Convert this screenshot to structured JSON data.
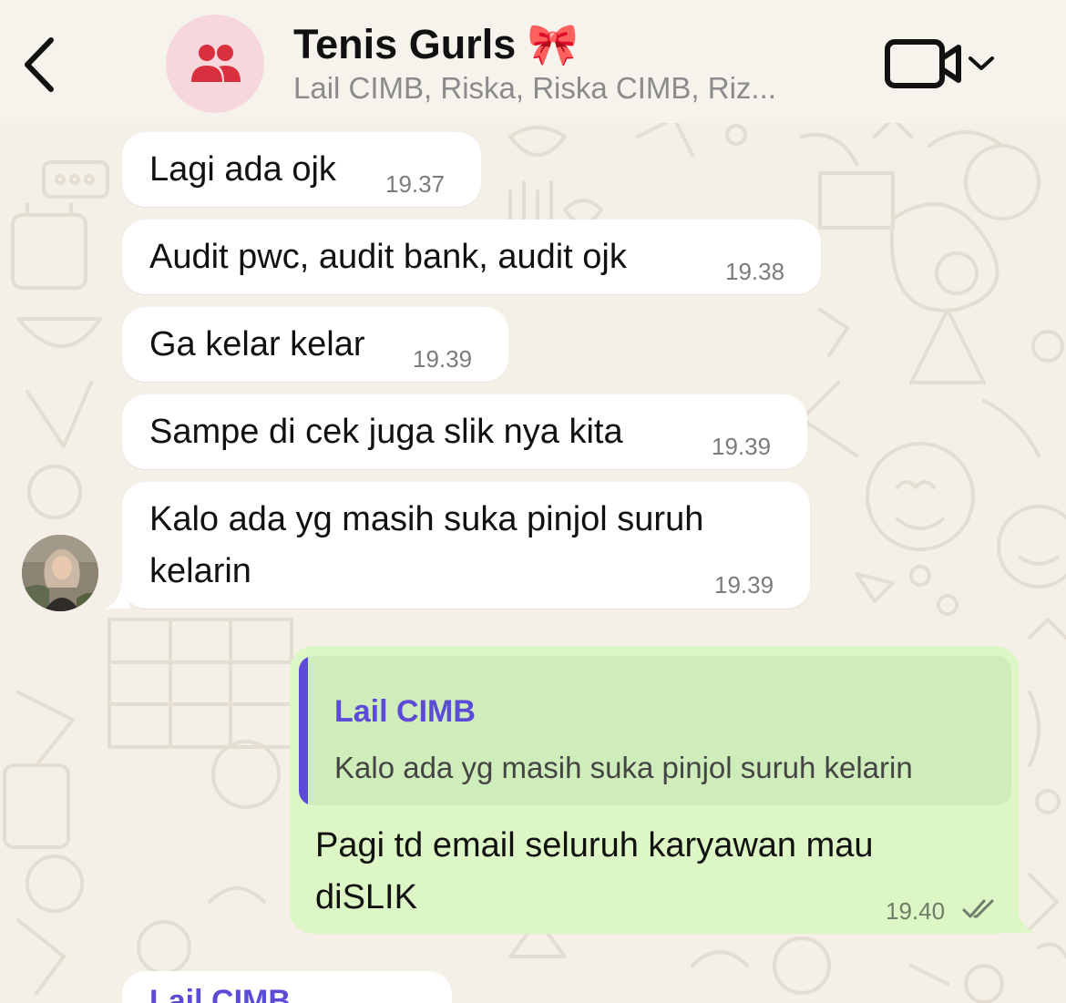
{
  "header": {
    "title": "Tenis Gurls 🎀",
    "subtitle": "Lail CIMB, Riska, Riska CIMB, Riz..."
  },
  "messages": [
    {
      "text": "Lagi ada ojk",
      "time": "19.37"
    },
    {
      "text": "Audit pwc, audit bank, audit ojk",
      "time": "19.38"
    },
    {
      "text": "Ga kelar kelar",
      "time": "19.39"
    },
    {
      "text": "Sampe di cek juga slik nya kita",
      "time": "19.39"
    },
    {
      "line1": "Kalo ada yg masih suka pinjol suruh",
      "line2": "kelarin",
      "time": "19.39"
    }
  ],
  "outgoing": {
    "quote_author": "Lail CIMB",
    "quote_text": "Kalo ada yg masih suka pinjol suruh kelarin",
    "line1": "Pagi td email seluruh karyawan mau",
    "line2": "diSLIK",
    "time": "19.40"
  },
  "next_message": {
    "sender": "Lail CIMB"
  },
  "colors": {
    "accent": "#5b4bd8",
    "outgoing_bubble": "#dcf7c5",
    "group_avatar_bg": "#f6d7dc",
    "group_icon": "#d9303f"
  }
}
